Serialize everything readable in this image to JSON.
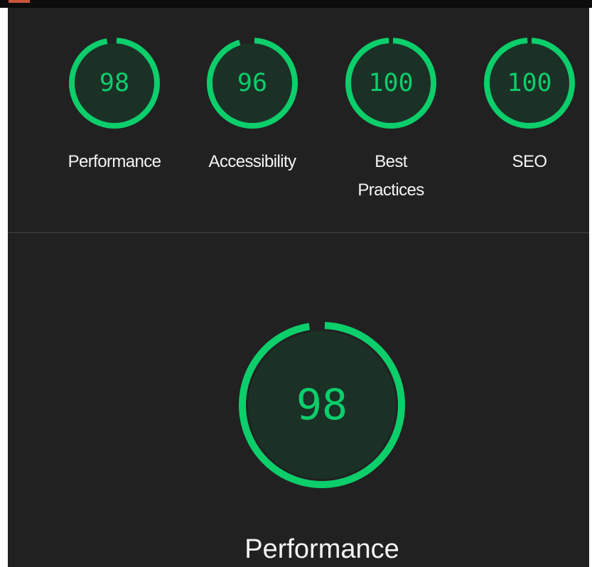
{
  "colors": {
    "pass": "#0cce6b",
    "gauge_fill": "#1b3126",
    "panel_bg": "#212121",
    "text": "#f4f4f4"
  },
  "summary": {
    "categories": [
      {
        "label": "Performance",
        "score": 98
      },
      {
        "label": "Accessibility",
        "score": 96
      },
      {
        "label": "Best Practices",
        "score": 100
      },
      {
        "label": "SEO",
        "score": 100
      }
    ]
  },
  "detail": {
    "label": "Performance",
    "score": 98
  }
}
